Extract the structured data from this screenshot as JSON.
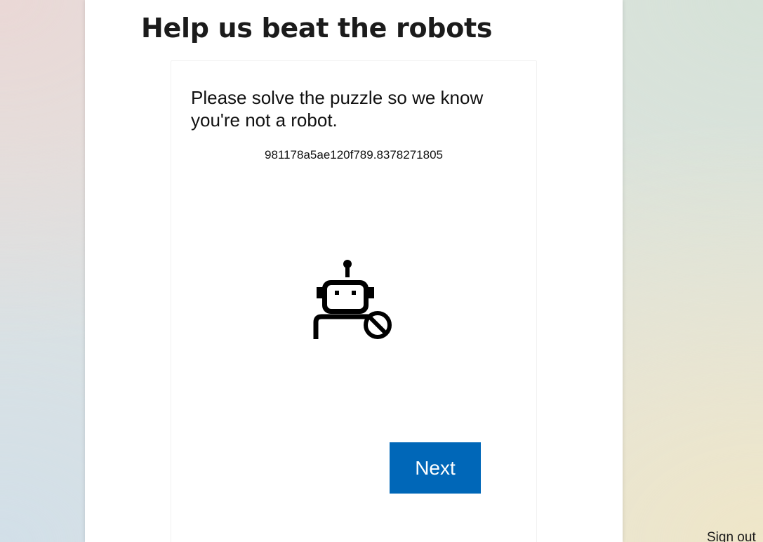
{
  "page": {
    "title": "Help us beat the robots"
  },
  "challenge": {
    "instruction": "Please solve the puzzle so we know you're not a robot.",
    "session_id": "981178a5ae120f789.8378271805",
    "icon": "robot-blocked-icon",
    "next_label": "Next"
  },
  "footer": {
    "sign_out_label": "Sign out"
  },
  "colors": {
    "accent": "#0067b8",
    "text": "#1b1b1b",
    "panel": "#ffffff"
  }
}
